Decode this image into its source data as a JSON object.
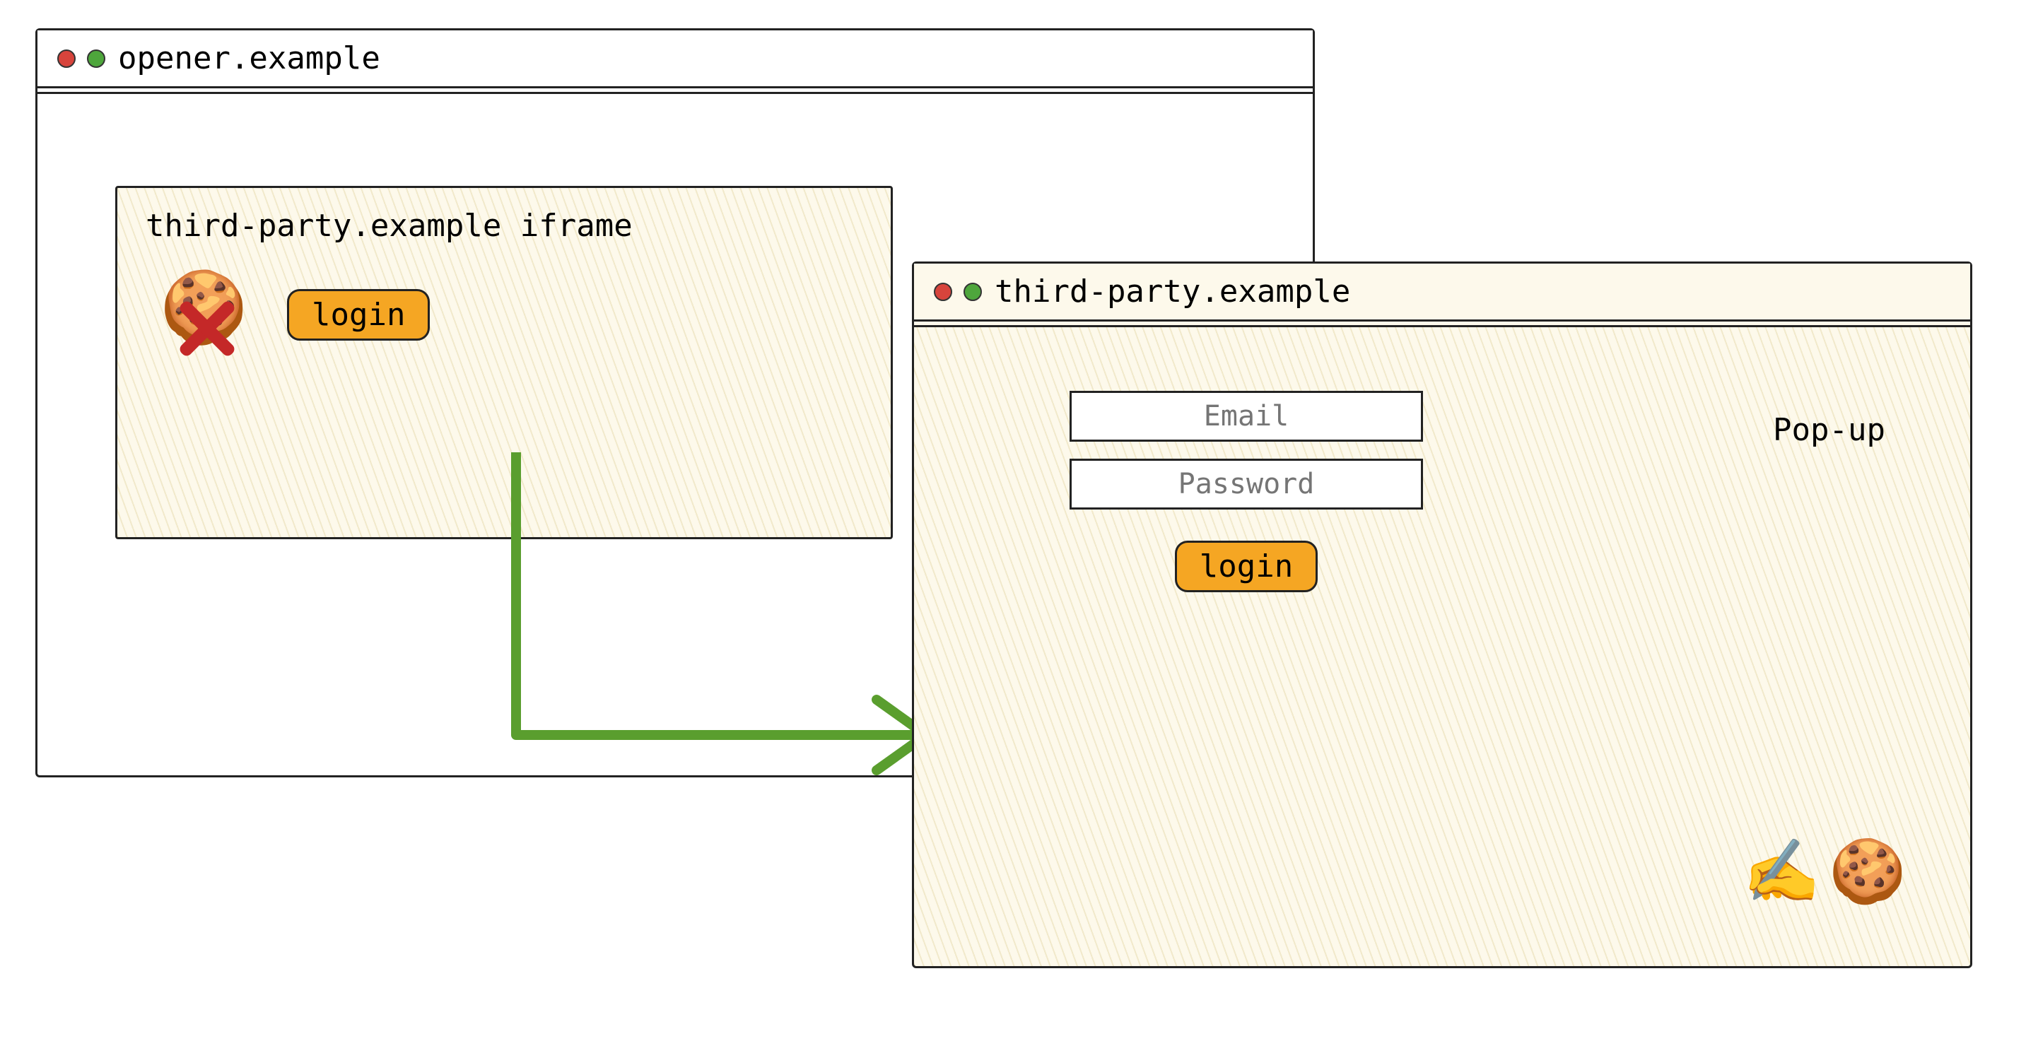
{
  "opener": {
    "title": "opener.example",
    "iframe": {
      "label": "third-party.example iframe",
      "login_label": "login",
      "cookie_icon": "cookie-icon",
      "blocked_icon": "x-blocked-icon"
    }
  },
  "popup": {
    "title": "third-party.example",
    "label": "Pop-up",
    "email_placeholder": "Email",
    "password_placeholder": "Password",
    "login_label": "login",
    "write_icon": "writing-hand-icon",
    "cookie_icon": "cookie-icon"
  },
  "arrow": {
    "color": "#5a9e2e"
  }
}
